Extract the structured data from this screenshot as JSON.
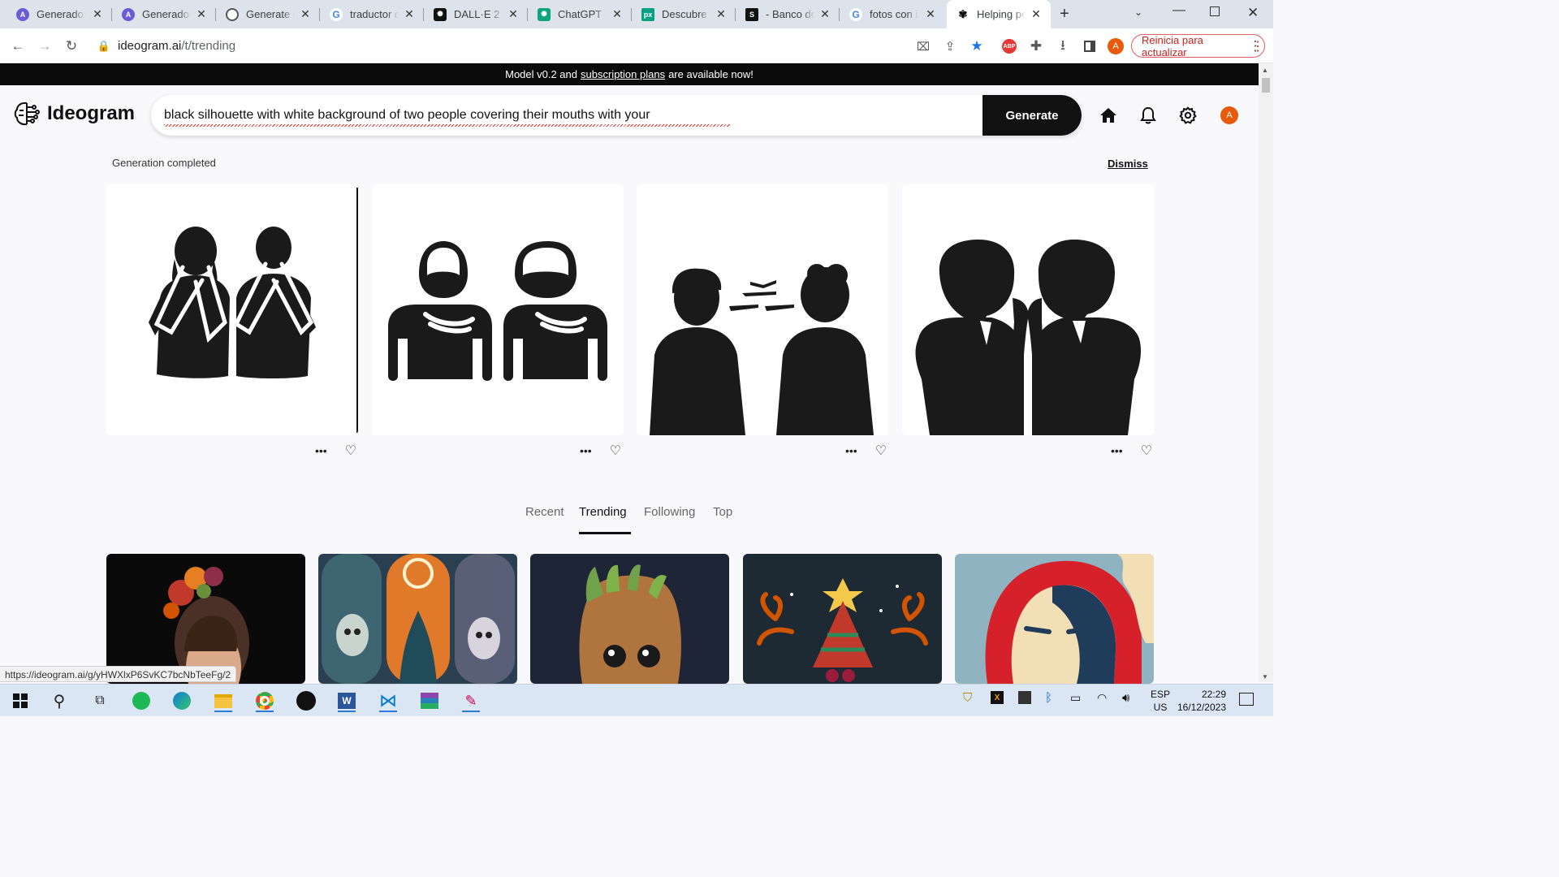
{
  "browser": {
    "tabs": [
      {
        "label": "Generador",
        "favicon": "A",
        "color": "#6b5bd6"
      },
      {
        "label": "Generador",
        "favicon": "A",
        "color": "#6b5bd6"
      },
      {
        "label": "Generate c",
        "favicon": "globe-icon",
        "color": "#444"
      },
      {
        "label": "traductor c",
        "favicon": "google-icon",
        "color": "#4285f4"
      },
      {
        "label": "DALL·E 2",
        "favicon": "openai-icon",
        "color": "#111"
      },
      {
        "label": "ChatGPT",
        "favicon": "openai-icon",
        "color": "#10a37f"
      },
      {
        "label": "Descubre y",
        "favicon": "px",
        "color": "#05a081"
      },
      {
        "label": "- Banco de",
        "favicon": "S",
        "color": "#111"
      },
      {
        "label": "fotos con i",
        "favicon": "google-icon",
        "color": "#4285f4"
      },
      {
        "label": "Helping pe",
        "favicon": "ideogram-icon",
        "color": "#111"
      }
    ],
    "url_domain": "ideogram.ai",
    "url_path": "/t/trending",
    "update_button": "Reinicia para actualizar",
    "profile_initial": "A",
    "status_url": "https://ideogram.ai/g/yHWXlxP6SvKC7bcNbTeeFg/2"
  },
  "banner": {
    "prefix": "Model v0.2 and",
    "link": "subscription plans",
    "suffix": "are available now!"
  },
  "header": {
    "logo": "Ideogram",
    "prompt_value": "black silhouette with white background of two people covering their mouths with your",
    "generate_label": "Generate",
    "avatar_initial": "A"
  },
  "generation": {
    "status": "Generation completed",
    "dismiss": "Dismiss",
    "images": [
      {
        "alt": "two silhouettes covering faces with hands"
      },
      {
        "alt": "two pictogram figures covering mouths"
      },
      {
        "alt": "two silhouettes facing each other"
      },
      {
        "alt": "two silhouettes whispering"
      }
    ]
  },
  "feed": {
    "tabs": [
      "Recent",
      "Trending",
      "Following",
      "Top"
    ],
    "active_tab": "Trending",
    "cards": [
      {
        "alt": "woman with flower crown"
      },
      {
        "alt": "three hooded skull figures"
      },
      {
        "alt": "baby groot character"
      },
      {
        "alt": "christmas tree with reindeer antlers"
      },
      {
        "alt": "red blue pop art portrait"
      }
    ]
  },
  "taskbar": {
    "lang_top": "ESP",
    "lang_bottom": "US",
    "time": "22:29",
    "date": "16/12/2023"
  },
  "colors": {
    "brand_dark": "#111111",
    "accent_orange": "#e8590c",
    "update_red": "#c5221f"
  }
}
